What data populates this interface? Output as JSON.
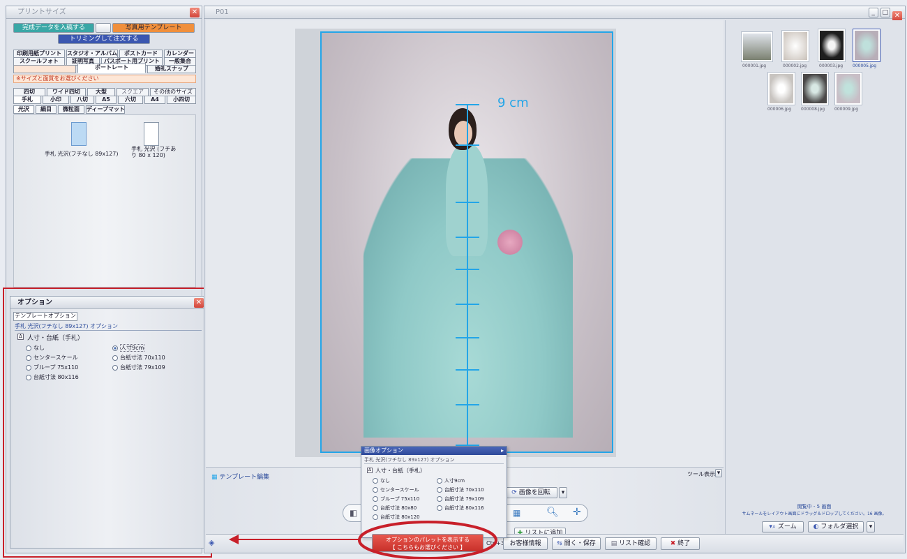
{
  "left_panel": {
    "title": "プリントサイズ",
    "top_buttons": [
      "完成データを入稿する",
      "",
      "写真用テンプレート"
    ],
    "trimming": "トリミングして注文する",
    "category_rows": [
      [
        "印刷用紙プリント",
        "スタジオ・アルバム",
        "ポストカード",
        "カレンダー"
      ],
      [
        "スクールフォト",
        "証明写真",
        "パスポート用プリント",
        "一般集合"
      ]
    ],
    "sub_row": [
      "",
      "ポートレート",
      "婚礼スナップ"
    ],
    "instruction": "※サイズと面質をお選びください",
    "size_row1": [
      "四切",
      "ワイド四切",
      "大型",
      "スクエア",
      "その他のサイズ"
    ],
    "size_row2": [
      "手札",
      "小印",
      "八切",
      "A5",
      "六切",
      "A4",
      "小四切"
    ],
    "finish_tabs": [
      "光沢",
      "絹目",
      "微粒面",
      "ディープマット"
    ],
    "products": [
      {
        "name": "手札 光沢(フチなし 89x127)"
      },
      {
        "name": "手札 光沢 (フチあり 80 x 120)"
      }
    ]
  },
  "option_panel": {
    "title": "オプション",
    "tab": "テンプレートオプション",
    "header": "手札 光沢(フチなし 89x127) オプション",
    "group": "人寸・台紙（手札）",
    "options_left": [
      "なし",
      "センタースケール",
      "ブループ 75x110",
      "台紙寸法 80x116"
    ],
    "options_right": [
      "人寸9cm",
      "台紙寸法 70x110",
      "台紙寸法 79x109"
    ],
    "selected": "人寸9cm"
  },
  "center": {
    "title": "P01",
    "measure_label": "9 cm",
    "template_edit": "テンプレート編集",
    "tool_display": "ツール表示",
    "rotate": "画像を回転",
    "add_list": "リストに追加",
    "options_button": "オプションのパレットを表示する",
    "options_button_sub": "【 こちらもお選びください 】",
    "shortcut": "Ctrl+3",
    "bottom_buttons": [
      "お客様情報",
      "開く・保存",
      "リスト確認",
      "終了"
    ]
  },
  "popup": {
    "title": "画像オプション",
    "header": "手札 光沢(フチなし 89x127) オプション",
    "group": "人寸・台紙（手札）",
    "options_left": [
      "なし",
      "センタースケール",
      "ブループ 75x110",
      "台紙寸法 80x80",
      "台紙寸法 80x120"
    ],
    "options_right": [
      "人寸9cm",
      "台紙寸法 70x110",
      "台紙寸法 79x109",
      "台紙寸法 80x116"
    ]
  },
  "right_panel": {
    "thumbnails_row1": [
      "000001.jpg",
      "000002.jpg",
      "000003.jpg",
      "000005.jpg"
    ],
    "thumbnails_row2": [
      "000006.jpg",
      "000008.jpg",
      "000009.jpg"
    ],
    "info_line1": "閲覧中 - 5 画面",
    "info_line2": "サムネールをレイアウト画面にドラッグ＆ドロップしてください。16 画像。",
    "zoom": "ズーム",
    "folder": "フォルダ選択"
  },
  "colors": {
    "accent_red": "#c8202a",
    "teal_button": "#3aa7a6",
    "orange_button": "#f08f3c",
    "blue_button": "#3b57b0",
    "scale_blue": "#23a5e8"
  }
}
